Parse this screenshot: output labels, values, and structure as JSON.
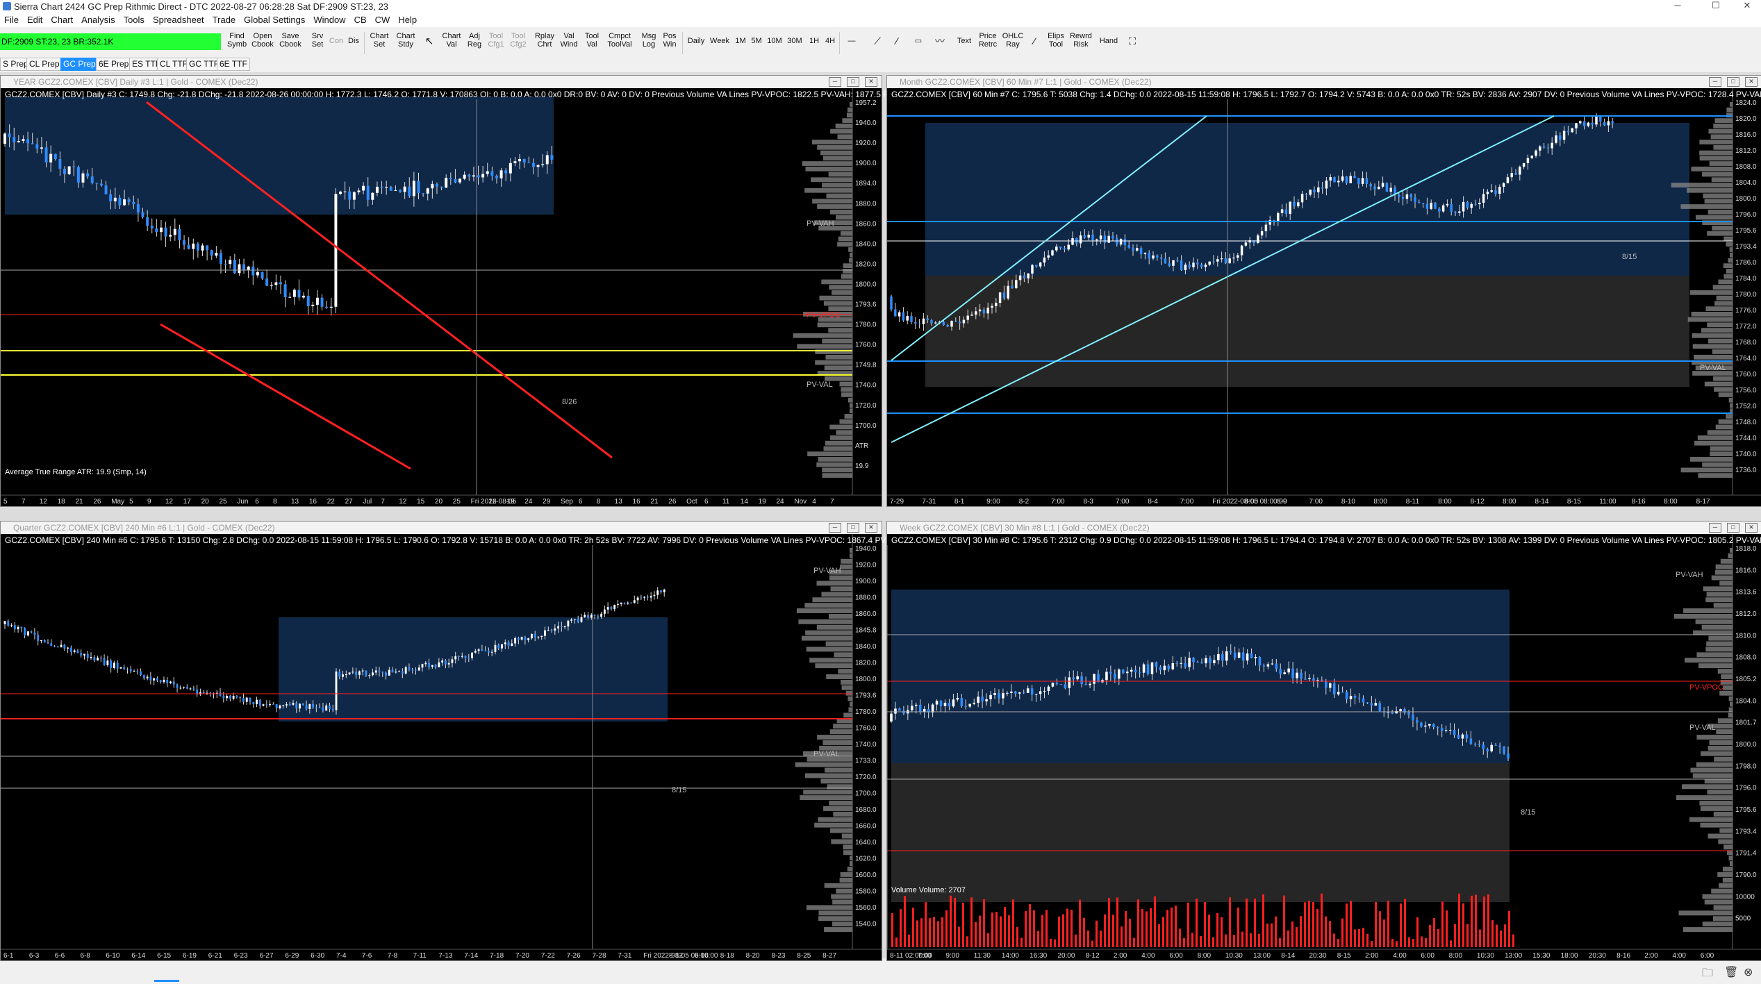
{
  "titlebar": {
    "title": "Sierra Chart 2424 GC Prep  Rithmic Direct - DTC 2022-08-27  06:28:28 Sat  DF:2909  ST:23, 23",
    "minimize": "─",
    "maximize": "☐",
    "close": "✕"
  },
  "menu": [
    "File",
    "Edit",
    "Chart",
    "Analysis",
    "Tools",
    "Spreadsheet",
    "Trade",
    "Global Settings",
    "Window",
    "CB",
    "CW",
    "Help"
  ],
  "status": {
    "text": "DF:2909  ST:23, 23  BR:352.1K"
  },
  "toolbar": {
    "find": "Find Symb",
    "open_cbook": "Open Cbook",
    "save_cbook": "Save Cbook",
    "srv_set": "Srv Set",
    "con": "Con",
    "dis": "Dis",
    "chart_set": "Chart Set",
    "chart_stdy": "Chart Stdy",
    "chart_val": "Chart Val",
    "adj_reg": "Adj Reg",
    "tool_cfg1": "Tool Cfg1",
    "tool_cfg2": "Tool Cfg2",
    "rplay": "Rplay Chrt",
    "val_wind": "Val Wind",
    "tool_val": "Tool Val",
    "cmpct": "Cmpct ToolVal",
    "msg_log": "Msg Log",
    "pos_win": "Pos Win",
    "daily": "Daily",
    "week": "Week",
    "m1": "1M",
    "m5": "5M",
    "m10": "10M",
    "m30": "30M",
    "h1": "1H",
    "h4": "4H",
    "text": "Text",
    "price_retrc": "Price Retrc",
    "ohlc_ray": "OHLC Ray",
    "elips_tool": "Elips Tool",
    "rewrd_risk": "Rewrd Risk",
    "hand": "Hand"
  },
  "tabs": [
    "S Prep",
    "CL Prep",
    "GC Prep",
    "6E Prep",
    "ES TTF",
    "CL TTF",
    "GC TTF",
    "6E TTF"
  ],
  "charts": [
    {
      "title": "YEAR GCZ2.COMEX [CBV]  Daily  #3 L:1 | Gold - COMEX (Dec22)",
      "header": "GCZ2.COMEX [CBV]  Daily  #3  C: 1749.8  Chg: -21.8  DChg: -21.8  2022-08-26 00:00:00 H: 1772.3 L: 1746.2 O: 1771.8 V: 170863 OI: 0 B: 0.0 A: 0.0 0x0 DR:0 BV: 0 AV: 0 DV: 0 Previous Volume VA Lines  PV-VPOC: 1822.5  PV-VAH: 1877.5  PV",
      "study": "Average True Range  ATR: 19.9  (Smp, 14)",
      "prices": [
        "1957.2",
        "1940.0",
        "1920.0",
        "1900.0",
        "1894.0",
        "1880.0",
        "1860.0",
        "1840.0",
        "1820.0",
        "1800.0",
        "1793.6",
        "1780.0",
        "1760.0",
        "1749.8",
        "1740.0",
        "1720.0",
        "1700.0",
        "ATR",
        "19.9"
      ],
      "labels": [
        "PV-VAH",
        "PV-VPOC",
        "PV-VAL",
        "8/26"
      ],
      "dates": [
        "5",
        "7",
        "12",
        "18",
        "21",
        "26",
        "May",
        "5",
        "9",
        "12",
        "17",
        "20",
        "25",
        "Jun",
        "6",
        "8",
        "13",
        "16",
        "22",
        "27",
        "Jul",
        "7",
        "12",
        "15",
        "20",
        "25",
        "Fri 2022-08-05",
        "16",
        "19",
        "24",
        "29",
        "Sep",
        "6",
        "8",
        "13",
        "16",
        "21",
        "26",
        "Oct",
        "6",
        "11",
        "14",
        "19",
        "24",
        "Nov",
        "4",
        "7"
      ]
    },
    {
      "title": "Month GCZ2.COMEX [CBV]  60 Min  #7 L:1 | Gold - COMEX (Dec22)",
      "header": "GCZ2.COMEX [CBV]  60 Min  #7  C: 1795.6  T: 5038  Chg: 1.4  DChg: 0.0  2022-08-15 11:59:08 H: 1796.5 L: 1792.7 O: 1794.2 V: 5743 B: 0.0 A: 0.0 0x0 TR: 52s BV: 2836 AV: 2907 DV: 0 Previous Volume VA Lines  PV-VPOC: 1728.4  PV-VAH",
      "prices": [
        "1824.0",
        "1820.0",
        "1816.0",
        "1812.0",
        "1808.0",
        "1804.0",
        "1800.0",
        "1796.0",
        "1795.6",
        "1793.4",
        "1786.0",
        "1784.0",
        "1780.0",
        "1776.0",
        "1772.0",
        "1768.0",
        "1764.0",
        "1760.0",
        "1756.0",
        "1752.0",
        "1748.0",
        "1744.0",
        "1740.0",
        "1736.0"
      ],
      "labels": [
        "PV-VAL",
        "8/15"
      ],
      "dates": [
        "7-29",
        "7-31",
        "8-1",
        "9:00",
        "8-2",
        "7:00",
        "8-3",
        "7:00",
        "8-4",
        "7:00",
        "Fri 2022-08-05  08:00:00",
        "8:00",
        "8-9",
        "7:00",
        "8-10",
        "8:00",
        "8-11",
        "8:00",
        "8-12",
        "8:00",
        "8-14",
        "8-15",
        "11:00",
        "8-16",
        "8:00",
        "8-17"
      ]
    },
    {
      "title": "Quarter GCZ2.COMEX [CBV]  240 Min  #6 L:1 | Gold - COMEX (Dec22)",
      "header": "GCZ2.COMEX [CBV]  240 Min  #6  C: 1795.6  T: 13150  Chg: 2.8  DChg: 0.0  2022-08-15 11:59:08 H: 1796.5 L: 1790.6 O: 1792.8 V: 15718 B: 0.0 A: 0.0 0x0 TR: 2h 52s BV: 7722 AV: 7996 DV: 0 Previous Volume VA Lines  PV-VPOC: 1867.4  PV-VAH",
      "prices": [
        "1940.0",
        "1920.0",
        "1900.0",
        "1880.0",
        "1860.0",
        "1845.8",
        "1840.0",
        "1820.0",
        "1800.0",
        "1793.6",
        "1780.0",
        "1760.0",
        "1740.0",
        "1733.0",
        "1720.0",
        "1700.0",
        "1680.0",
        "1660.0",
        "1640.0",
        "1620.0",
        "1600.0",
        "1580.0",
        "1560.0",
        "1540.0"
      ],
      "labels": [
        "PV-VAH",
        "PV-VAL",
        "8/15"
      ],
      "dates": [
        "6-1",
        "6-3",
        "6-6",
        "6-8",
        "6-10",
        "6-14",
        "6-15",
        "6-19",
        "6-21",
        "6-23",
        "6-27",
        "6-29",
        "6-30",
        "7-4",
        "7-6",
        "7-8",
        "7-11",
        "7-13",
        "7-14",
        "7-18",
        "7-20",
        "7-22",
        "7-26",
        "7-28",
        "7-31",
        "Fri 2022-08-05  06:00:00",
        "8-12",
        "8-16",
        "8-18",
        "8-20",
        "8-23",
        "8-25",
        "8-27"
      ]
    },
    {
      "title": "Week GCZ2.COMEX [CBV]  30 Min  #8 L:1 | Gold - COMEX (Dec22)",
      "header": "GCZ2.COMEX [CBV]  30 Min  #8  C: 1795.6  T: 2312  Chg: 0.9  DChg: 0.0  2022-08-15 11:59:08 H: 1796.5 L: 1794.4 O: 1794.8 V: 2707 B: 0.0 A: 0.0 0x0 TR: 52s BV: 1308 AV: 1399 DV: 0 Previous Volume VA Lines  PV-VPOC: 1805.2  PV-VAH: 176",
      "study": "Volume  Volume: 2707",
      "prices": [
        "1818.0",
        "1816.0",
        "1813.6",
        "1812.0",
        "1810.0",
        "1808.0",
        "1805.2",
        "1804.0",
        "1801.7",
        "1800.0",
        "1798.0",
        "1796.0",
        "1795.6",
        "1793.4",
        "1791.4",
        "1790.0",
        "10000",
        "5000"
      ],
      "labels": [
        "PV-VAH",
        "PV-VPOC",
        "PV-VAL",
        "8/15"
      ],
      "dates": [
        "8-11  02:00:00",
        "7:00",
        "9:00",
        "11:30",
        "14:00",
        "16:30",
        "20:00",
        "8-12",
        "2:00",
        "4:00",
        "6:00",
        "8:00",
        "10:30",
        "13:00",
        "8-14",
        "20:30",
        "8-15",
        "2:00",
        "4:00",
        "6:00",
        "8:00",
        "10:30",
        "13:00",
        "15:30",
        "18:00",
        "20:30",
        "8-16",
        "2:00",
        "4:00",
        "6:00"
      ]
    }
  ]
}
